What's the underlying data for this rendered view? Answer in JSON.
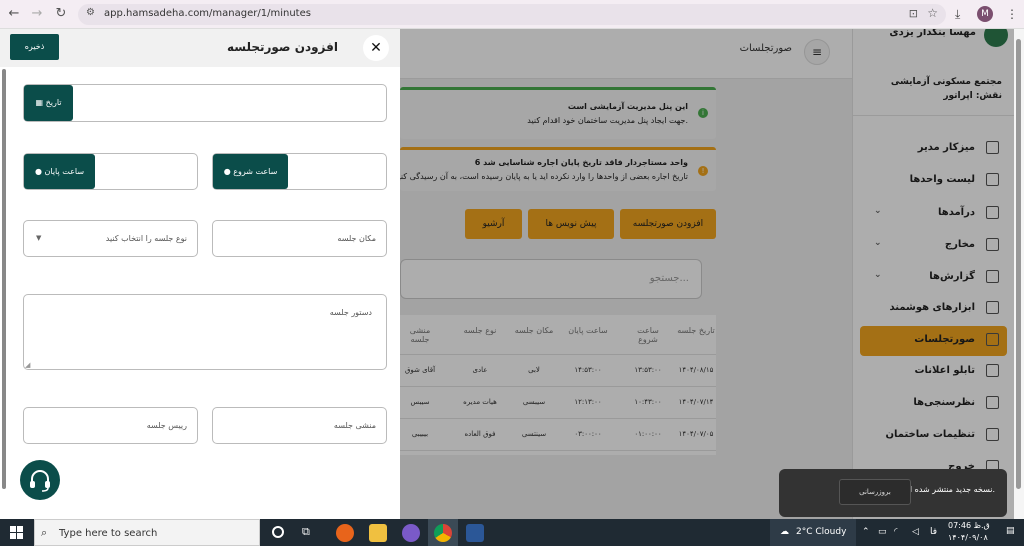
{
  "browser": {
    "url": "app.hamsadeha.com/manager/1/minutes",
    "profile_initial": "M"
  },
  "sidebar": {
    "user_name": "مهسا بنکدار یزدی",
    "complex_name": "مجتمع مسکونی آزمایشی",
    "role": "نقش: اپراتور",
    "items": [
      {
        "label": "میزکار مدیر",
        "icon": "dashboard-icon"
      },
      {
        "label": "لیست واحدها",
        "icon": "building-icon"
      },
      {
        "label": "درآمدها",
        "icon": "income-icon",
        "expandable": true
      },
      {
        "label": "مخارج",
        "icon": "card-icon",
        "expandable": true
      },
      {
        "label": "گزارش‌ها",
        "icon": "report-icon",
        "expandable": true
      },
      {
        "label": "ابزارهای هوشمند",
        "icon": "robot-icon"
      },
      {
        "label": "صورتجلسات",
        "icon": "minutes-icon",
        "active": true
      },
      {
        "label": "تابلو اعلانات",
        "icon": "board-icon"
      },
      {
        "label": "نظرسنجی‌ها",
        "icon": "poll-icon"
      },
      {
        "label": "تنظیمات ساختمان",
        "icon": "settings-icon"
      },
      {
        "label": "خروج",
        "icon": "logout-icon"
      }
    ]
  },
  "topbar": {
    "title": "صورتجلسات"
  },
  "alerts": [
    {
      "line1": "این پنل مدیریت آزمایشی است",
      "line2": "جهت ایجاد پنل مدیریت ساختمان خود اقدام کنید.",
      "color": "#4caf50"
    },
    {
      "line1": "6 واحد مستاجردار فاقد تاریخ پایان اجاره شناسایی شد",
      "line2": "تاریخ اجاره بعضی از واحدها را وارد نکرده اید یا به پایان رسیده است، به آن رسیدگی کنید",
      "color": "#f2a51f"
    }
  ],
  "actions": {
    "add": "افزودن صورتجلسه",
    "drafts": "پیش نویس ها",
    "archive": "آرشیو"
  },
  "search_placeholder": "جستجو...",
  "table": {
    "headers": [
      "تاریخ جلسه",
      "ساعت شروع",
      "ساعت پایان",
      "مکان جلسه",
      "نوع جلسه",
      "منشی جلسه"
    ],
    "rows": [
      [
        "۱۴۰۴/۰۸/۱۵",
        "۱۳:۵۳:۰۰",
        "۱۴:۵۳:۰۰",
        "لابی",
        "عادی",
        "آقای شوق"
      ],
      [
        "۱۴۰۴/۰۷/۱۴",
        "۱۰:۴۳:۰۰",
        "۱۲:۱۳:۰۰",
        "سیبسی",
        "هیات مدیره",
        "سیبس"
      ],
      [
        "۱۴۰۴/۰۷/۰۵",
        "۰۱:۰۰:۰۰",
        "۰۳:۰۰:۰۰",
        "سینتسی",
        "فوق العاده",
        "بیبیبی"
      ]
    ]
  },
  "drawer": {
    "title": "افزودن صورتجلسه",
    "save": "ذخیره",
    "date_btn": "تاریخ",
    "start_btn": "ساعت شروع",
    "end_btn": "ساعت پایان",
    "location_ph": "مکان جلسه",
    "type_ph": "نوع جلسه را انتخاب کنید",
    "agenda_ph": "دستور جلسه",
    "secretary_ph": "منشی جلسه",
    "chair_ph": "رییس جلسه"
  },
  "toast": {
    "text": "نسخه جدید منتشر شده است.",
    "button": "بروزرسانی"
  },
  "taskbar": {
    "search": "Type here to search",
    "weather": "2°C  Cloudy",
    "lang": "فا",
    "time": "07:46 ق.ظ",
    "date": "۱۴۰۴/۰۹/۰۸"
  }
}
